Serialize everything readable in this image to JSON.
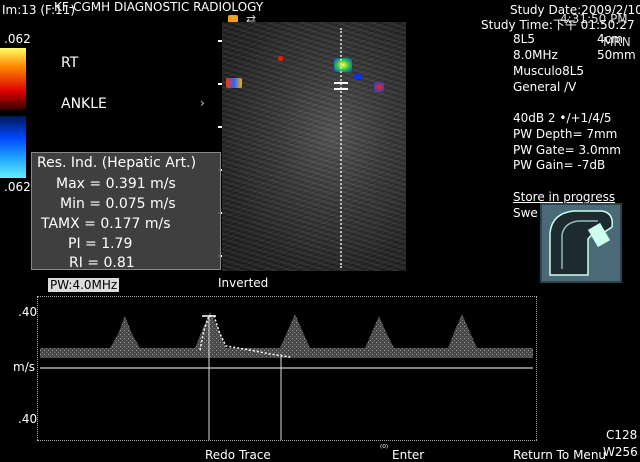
{
  "header": {
    "hospital": "KF-CGMH  DIAGNOSTIC RADIOLOGY",
    "image_number": "Im:13  (F:11)",
    "study_date": "Study Date:2009/2/10",
    "study_time": "Study Time:下午 01:50:27",
    "clock": "4:31:50 PM",
    "pm": "PM"
  },
  "probe": {
    "model": "8L5",
    "freq": "8.0MHz",
    "preset": "Musculo8L5",
    "mode": "General /V",
    "depth_cm": "4cm",
    "depth_mm": "50mm",
    "mode_code": "MRN"
  },
  "params": {
    "gain_line": "40dB  2 •/+1/4/5",
    "pw_depth": "PW Depth=   7mm",
    "pw_gate": "PW Gate= 3.0mm",
    "pw_gain": "PW Gain=  -7dB"
  },
  "colorbar": {
    "top_label": ".062",
    "bottom_label": ".062",
    "colors": [
      "#ffff66",
      "#ff8800",
      "#dd0000",
      "#440000",
      "#001a55",
      "#0044ff",
      "#33ddff"
    ]
  },
  "labels": {
    "side": "RT",
    "region": "ANKLE",
    "pw_freq": "PW:4.0MHz",
    "inverted": "Inverted"
  },
  "resistive_index": {
    "title": "Res. Ind. (Hepatic Art.)",
    "rows": [
      {
        "label": "Max = 0.391 m/s"
      },
      {
        "label": "Min = 0.075 m/s"
      },
      {
        "label": "TAMX = 0.177 m/s"
      },
      {
        "label": "PI = 1.79"
      },
      {
        "label": "RI = 0.81"
      }
    ]
  },
  "spectrum_axis": {
    "top": ".40",
    "unit": "m/s",
    "bottom": ".40"
  },
  "status": {
    "store": "Store in progress",
    "sweep": "Swe"
  },
  "footer": {
    "redo": "Redo Trace",
    "enter_icon": "⁽⁰⁾",
    "enter": "Enter",
    "return": "Return To Menu",
    "c_value": "C128",
    "w_value": "W256"
  },
  "accent": {
    "highlight": "#f0a020",
    "trace": "#ffffff"
  }
}
